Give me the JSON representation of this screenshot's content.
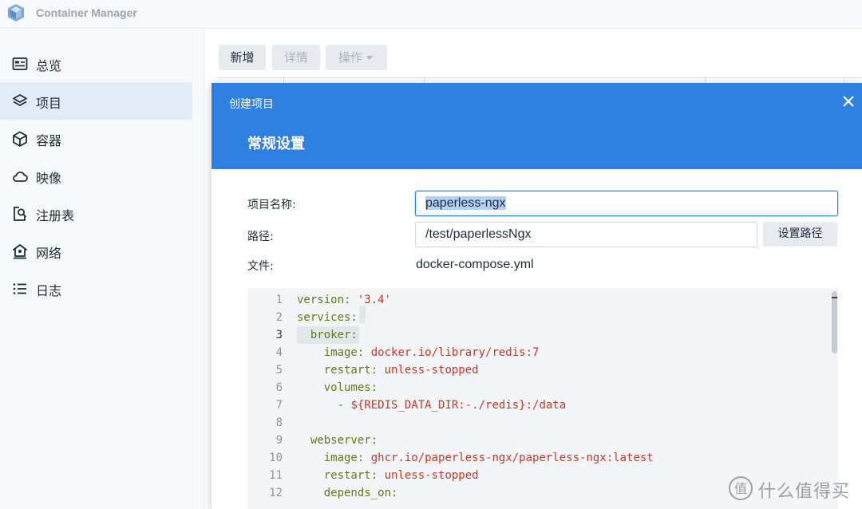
{
  "app": {
    "title": "Container Manager",
    "logo_icon": "container-manager-logo-icon"
  },
  "sidebar": {
    "items": [
      {
        "label": "总览",
        "icon": "overview-icon",
        "active": false
      },
      {
        "label": "项目",
        "icon": "layers-icon",
        "active": true
      },
      {
        "label": "容器",
        "icon": "cube-icon",
        "active": false
      },
      {
        "label": "映像",
        "icon": "cloud-icon",
        "active": false
      },
      {
        "label": "注册表",
        "icon": "registry-search-icon",
        "active": false
      },
      {
        "label": "网络",
        "icon": "network-icon",
        "active": false
      },
      {
        "label": "日志",
        "icon": "list-icon",
        "active": false
      }
    ]
  },
  "toolbar": {
    "create_label": "新增",
    "details_label": "详情",
    "action_label": "操作",
    "action_icon": "caret-down-icon"
  },
  "dialog": {
    "title": "创建项目",
    "section": "常规设置",
    "close_icon": "close-icon",
    "fields": {
      "name_label": "项目名称:",
      "name_value": "paperless-ngx",
      "path_label": "路径:",
      "path_value": "/test/paperlessNgx",
      "set_path_label": "设置路径",
      "file_label": "文件:",
      "file_value": "docker-compose.yml"
    },
    "editor": {
      "current_line": 3,
      "lines": [
        {
          "num": "1",
          "text": "version: '3.4'"
        },
        {
          "num": "2",
          "text": "services:"
        },
        {
          "num": "3",
          "text": "  broker:"
        },
        {
          "num": "4",
          "text": "    image: docker.io/library/redis:7"
        },
        {
          "num": "5",
          "text": "    restart: unless-stopped"
        },
        {
          "num": "6",
          "text": "    volumes:"
        },
        {
          "num": "7",
          "text": "      - ${REDIS_DATA_DIR:-./redis}:/data"
        },
        {
          "num": "8",
          "text": ""
        },
        {
          "num": "9",
          "text": "  webserver:"
        },
        {
          "num": "10",
          "text": "    image: ghcr.io/paperless-ngx/paperless-ngx:latest"
        },
        {
          "num": "11",
          "text": "    restart: unless-stopped"
        },
        {
          "num": "12",
          "text": "    depends_on:"
        }
      ]
    }
  },
  "watermark": {
    "text": "什么值得买",
    "icon": "smzdm-logo-icon"
  },
  "colors": {
    "accent": "#2f7fe0",
    "key": "#5a7a17",
    "string": "#c0392b"
  }
}
